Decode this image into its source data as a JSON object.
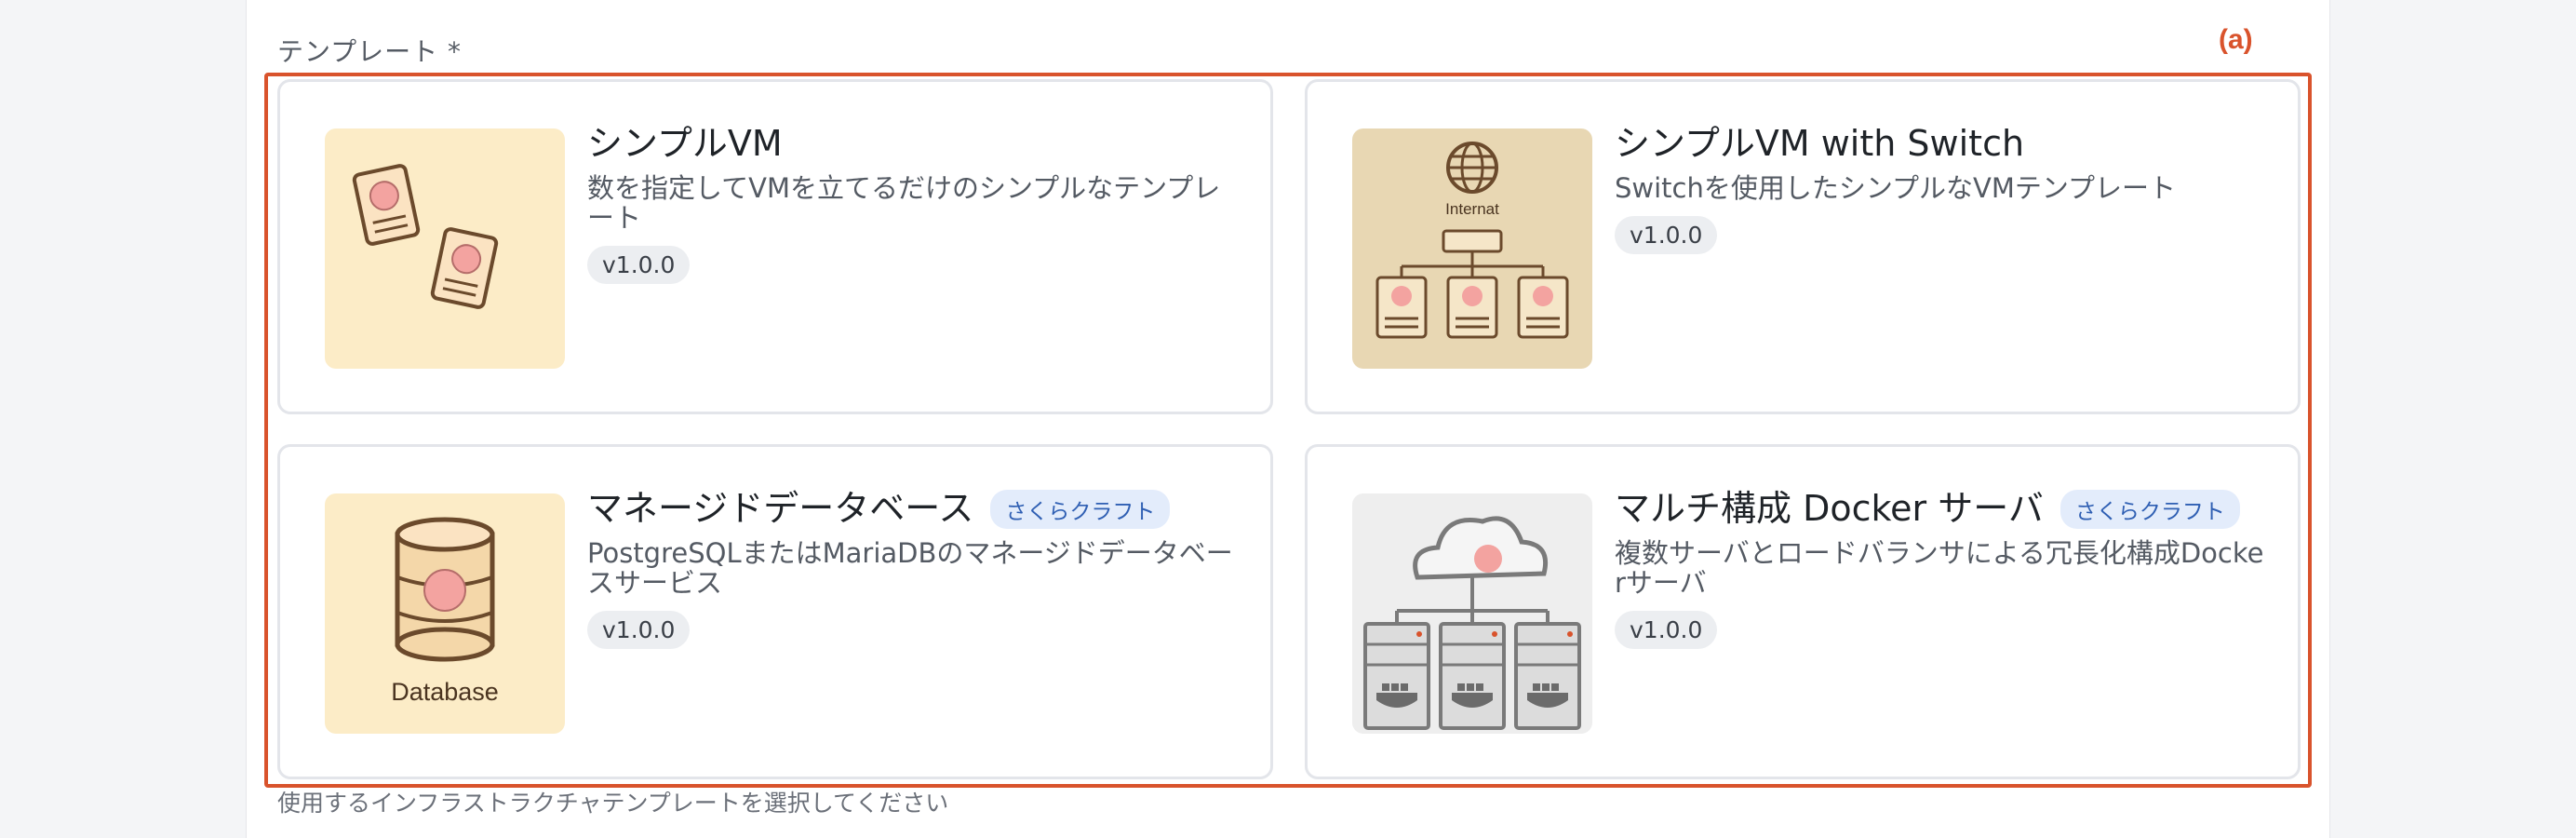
{
  "field": {
    "label": "テンプレート *",
    "help": "使用するインフラストラクチャテンプレートを選択してください"
  },
  "annotation": "(a)",
  "templates": [
    {
      "title": "シンプルVM",
      "badge": "",
      "description": "数を指定してVMを立てるだけのシンプルなテンプレート",
      "version": "v1.0.0",
      "icon": "vm-cards-icon"
    },
    {
      "title": "シンプルVM with Switch",
      "badge": "",
      "description": "Switchを使用したシンプルなVMテンプレート",
      "version": "v1.0.0",
      "icon": "network-switch-icon",
      "icon_label": "Internat"
    },
    {
      "title": "マネージドデータベース",
      "badge": "さくらクラフト",
      "description": "PostgreSQLまたはMariaDBのマネージドデータベースサービス",
      "version": "v1.0.0",
      "icon": "database-icon",
      "icon_label": "Database"
    },
    {
      "title": "マルチ構成 Docker サーバ",
      "badge": "さくらクラフト",
      "description": "複数サーバとロードバランサによる冗長化構成Dockerサーバ",
      "version": "v1.0.0",
      "icon": "docker-cloud-icon"
    }
  ],
  "colors": {
    "accent": "#d9532c",
    "badge_text": "#2f5fb3",
    "badge_bg": "#e3ecfb",
    "thumb_bg_light": "#fcecc7",
    "thumb_bg_tan": "#e8d7b3"
  }
}
